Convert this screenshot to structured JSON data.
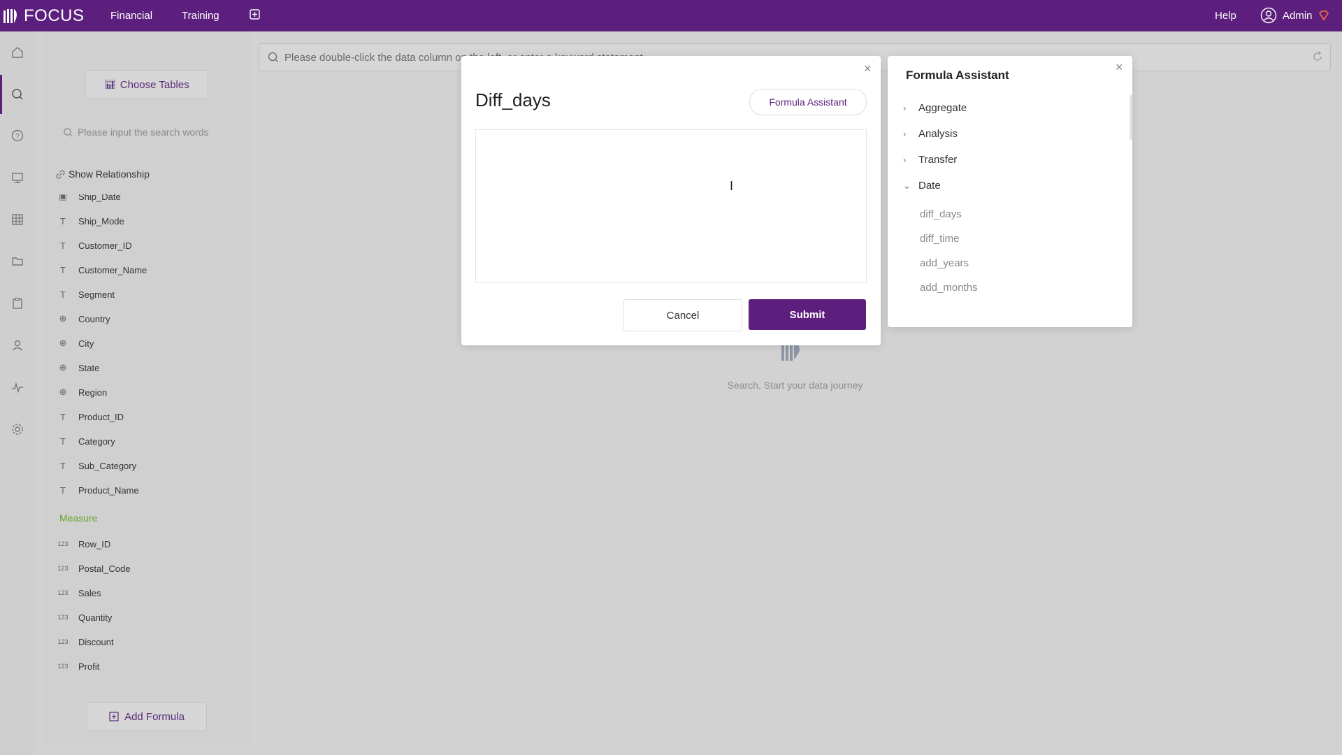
{
  "header": {
    "logo_text": "FOCUS",
    "nav": [
      "Financial",
      "Training"
    ],
    "help": "Help",
    "user": "Admin"
  },
  "rail_icons": [
    "home-icon",
    "search-icon",
    "help-circle-icon",
    "presentation-icon",
    "table-icon",
    "folder-icon",
    "clipboard-icon",
    "user-icon",
    "pulse-icon",
    "gear-icon"
  ],
  "fields_panel": {
    "choose_tables": "Choose Tables",
    "search_placeholder": "Please input the search words",
    "show_relationship": "Show Relationship",
    "dimensions": [
      {
        "name": "Ship_Date",
        "type": "date"
      },
      {
        "name": "Ship_Mode",
        "type": "text"
      },
      {
        "name": "Customer_ID",
        "type": "text"
      },
      {
        "name": "Customer_Name",
        "type": "text"
      },
      {
        "name": "Segment",
        "type": "text"
      },
      {
        "name": "Country",
        "type": "geo"
      },
      {
        "name": "City",
        "type": "geo"
      },
      {
        "name": "State",
        "type": "geo"
      },
      {
        "name": "Region",
        "type": "geo"
      },
      {
        "name": "Product_ID",
        "type": "text"
      },
      {
        "name": "Category",
        "type": "text"
      },
      {
        "name": "Sub_Category",
        "type": "text"
      },
      {
        "name": "Product_Name",
        "type": "text"
      }
    ],
    "measure_label": "Measure",
    "measures": [
      "Row_ID",
      "Postal_Code",
      "Sales",
      "Quantity",
      "Discount",
      "Profit"
    ],
    "add_formula": "Add Formula"
  },
  "main_search": {
    "placeholder": "Please double-click the data column on the left, or enter a keyword statement"
  },
  "empty_state": {
    "text": "Search, Start your data journey"
  },
  "formula_modal": {
    "title": "Diff_days",
    "assistant_button": "Formula Assistant",
    "editor_value": "",
    "cancel": "Cancel",
    "submit": "Submit",
    "close": "×"
  },
  "assistant": {
    "title": "Formula Assistant",
    "close": "×",
    "categories": [
      {
        "label": "Aggregate",
        "expanded": false
      },
      {
        "label": "Analysis",
        "expanded": false
      },
      {
        "label": "Transfer",
        "expanded": false
      },
      {
        "label": "Date",
        "expanded": true
      }
    ],
    "date_functions": [
      "diff_days",
      "diff_time",
      "add_years",
      "add_months"
    ]
  },
  "colors": {
    "brand": "#5c1f7d",
    "measure": "#6aa52a"
  }
}
